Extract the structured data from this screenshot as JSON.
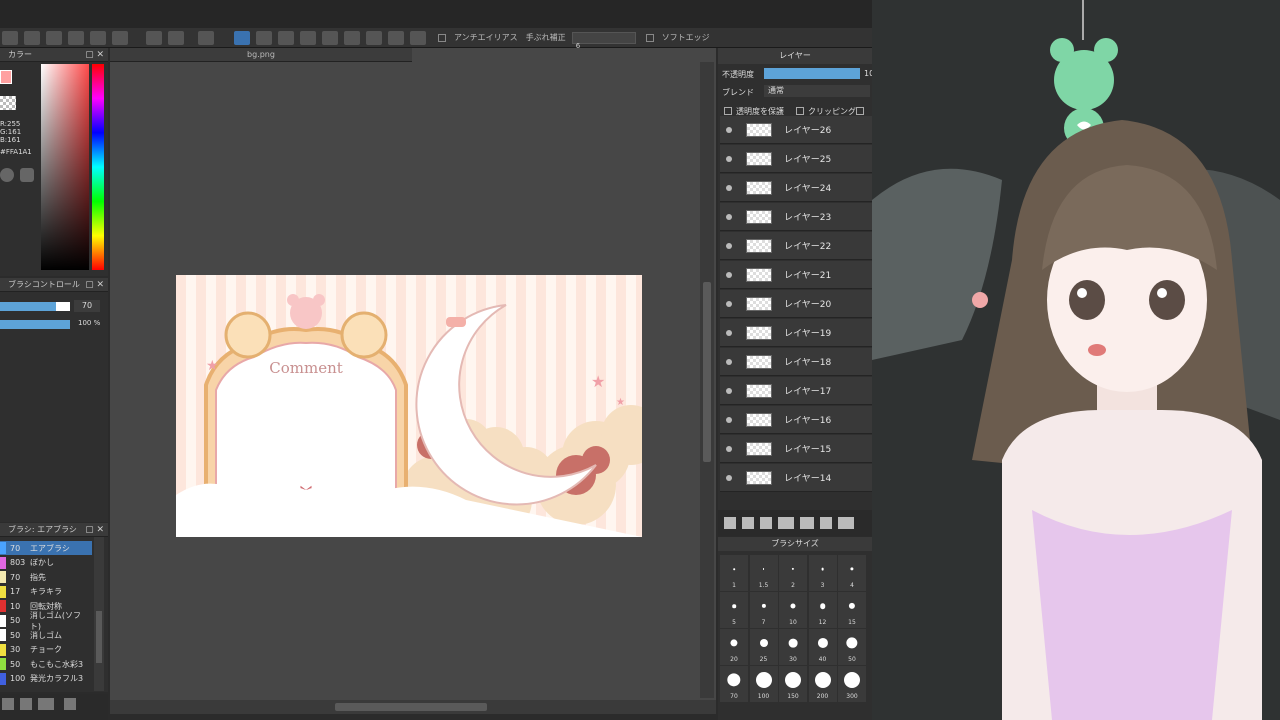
{
  "toolbar": {
    "antialias_label": "アンチエイリアス",
    "stabilizer_label": "手ぶれ補正",
    "stabilizer_value": "6",
    "soft_edge_label": "ソフトエッジ"
  },
  "color_panel": {
    "title": "カラー",
    "r": "R:255",
    "g": "G:161",
    "b": "B:161",
    "hex": "#FFA1A1"
  },
  "brush_control": {
    "title": "ブラシコントロール",
    "size_value": "70",
    "opacity_value": "100 %"
  },
  "brush_panel": {
    "title": "ブラシ: エアブラシ",
    "items": [
      {
        "size": "70",
        "name": "エアブラシ",
        "color": "#4aa3ff"
      },
      {
        "size": "803",
        "name": "ぼかし",
        "color": "#e067e0"
      },
      {
        "size": "70",
        "name": "指先",
        "color": "#f3e9b0"
      },
      {
        "size": "17",
        "name": "キラキラ",
        "color": "#f0e040"
      },
      {
        "size": "10",
        "name": "回転対称",
        "color": "#e03030"
      },
      {
        "size": "50",
        "name": "消しゴム(ソフト)",
        "color": "#ffffff"
      },
      {
        "size": "50",
        "name": "消しゴム",
        "color": "#ffffff"
      },
      {
        "size": "30",
        "name": "チョーク",
        "color": "#f0e040"
      },
      {
        "size": "50",
        "name": "もこもこ水彩3",
        "color": "#90e040"
      },
      {
        "size": "100",
        "name": "発光カラフル3",
        "color": "#4060e0"
      }
    ]
  },
  "document": {
    "tab_name": "bg.png",
    "art_text": "Comment"
  },
  "layer_panel": {
    "title": "レイヤー",
    "opacity_label": "不透明度",
    "opacity_value": "10",
    "blend_label": "ブレンド",
    "blend_value": "通常",
    "protect_alpha_label": "透明度を保護",
    "clipping_label": "クリッピング",
    "layers": [
      "レイヤー26",
      "レイヤー25",
      "レイヤー24",
      "レイヤー23",
      "レイヤー22",
      "レイヤー21",
      "レイヤー20",
      "レイヤー19",
      "レイヤー18",
      "レイヤー17",
      "レイヤー16",
      "レイヤー15",
      "レイヤー14"
    ]
  },
  "brush_size_panel": {
    "title": "ブラシサイズ",
    "sizes": [
      "1",
      "1.5",
      "2",
      "3",
      "4",
      "5",
      "7",
      "10",
      "12",
      "15",
      "20",
      "25",
      "30",
      "40",
      "50",
      "70",
      "100",
      "150",
      "200",
      "300"
    ]
  },
  "colors": {
    "accent": "#3a72b0",
    "current_color": "#FFA1A1"
  }
}
